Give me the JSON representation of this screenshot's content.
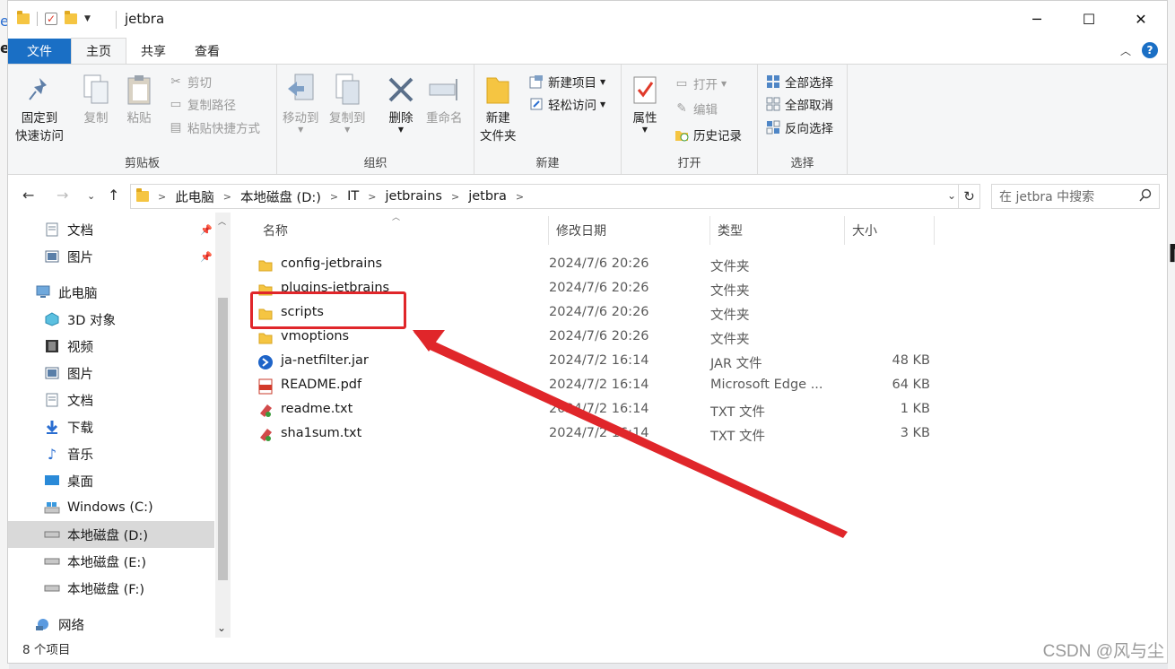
{
  "window": {
    "title": "jetbra",
    "controls": {
      "minimize": "─",
      "maximize": "☐",
      "close": "✕"
    }
  },
  "ribbon_tabs": [
    "文件",
    "主页",
    "共享",
    "查看"
  ],
  "ribbon": {
    "clipboard": {
      "label": "剪贴板",
      "pin": [
        "固定到",
        "快速访问"
      ],
      "copy": "复制",
      "paste": "粘贴",
      "cut": "剪切",
      "copy_path": "复制路径",
      "paste_shortcut": "粘贴快捷方式"
    },
    "organize": {
      "label": "组织",
      "move_to": "移动到",
      "copy_to": "复制到",
      "delete": "删除",
      "rename": "重命名"
    },
    "new": {
      "label": "新建",
      "new_folder": [
        "新建",
        "文件夹"
      ],
      "new_item": "新建项目",
      "easy_access": "轻松访问"
    },
    "open": {
      "label": "打开",
      "properties": "属性",
      "open": "打开",
      "edit": "编辑",
      "history": "历史记录"
    },
    "select": {
      "label": "选择",
      "select_all": "全部选择",
      "select_none": "全部取消",
      "invert": "反向选择"
    }
  },
  "address": {
    "crumbs": [
      "此电脑",
      "本地磁盘 (D:)",
      "IT",
      "jetbrains",
      "jetbra"
    ],
    "search_placeholder": "在 jetbra 中搜索"
  },
  "nav": {
    "quick": [
      {
        "label": "文档",
        "icon": "document-icon"
      },
      {
        "label": "图片",
        "icon": "picture-icon"
      }
    ],
    "this_pc": "此电脑",
    "pc_items": [
      {
        "label": "3D 对象",
        "icon": "3d-objects-icon"
      },
      {
        "label": "视频",
        "icon": "video-icon"
      },
      {
        "label": "图片",
        "icon": "picture-icon"
      },
      {
        "label": "文档",
        "icon": "document-icon"
      },
      {
        "label": "下载",
        "icon": "download-icon"
      },
      {
        "label": "音乐",
        "icon": "music-icon"
      },
      {
        "label": "桌面",
        "icon": "desktop-icon"
      },
      {
        "label": "Windows (C:)",
        "icon": "windows-drive-icon"
      },
      {
        "label": "本地磁盘 (D:)",
        "icon": "drive-icon",
        "selected": true
      },
      {
        "label": "本地磁盘 (E:)",
        "icon": "drive-icon"
      },
      {
        "label": "本地磁盘 (F:)",
        "icon": "drive-icon"
      }
    ],
    "network": "网络"
  },
  "columns": {
    "name": "名称",
    "date": "修改日期",
    "type": "类型",
    "size": "大小"
  },
  "files": [
    {
      "name": "config-jetbrains",
      "date": "2024/7/6 20:26",
      "type": "文件夹",
      "size": "",
      "icon": "folder-icon"
    },
    {
      "name": "plugins-jetbrains",
      "date": "2024/7/6 20:26",
      "type": "文件夹",
      "size": "",
      "icon": "folder-icon"
    },
    {
      "name": "scripts",
      "date": "2024/7/6 20:26",
      "type": "文件夹",
      "size": "",
      "icon": "folder-icon"
    },
    {
      "name": "vmoptions",
      "date": "2024/7/6 20:26",
      "type": "文件夹",
      "size": "",
      "icon": "folder-icon"
    },
    {
      "name": "ja-netfilter.jar",
      "date": "2024/7/2 16:14",
      "type": "JAR 文件",
      "size": "48 KB",
      "icon": "jar-icon"
    },
    {
      "name": "README.pdf",
      "date": "2024/7/2 16:14",
      "type": "Microsoft Edge ...",
      "size": "64 KB",
      "icon": "pdf-icon"
    },
    {
      "name": "readme.txt",
      "date": "2024/7/2 16:14",
      "type": "TXT 文件",
      "size": "1 KB",
      "icon": "txt-icon"
    },
    {
      "name": "sha1sum.txt",
      "date": "2024/7/2 16:14",
      "type": "TXT 文件",
      "size": "3 KB",
      "icon": "txt-icon"
    }
  ],
  "status": "8 个项目",
  "watermark": "CSDN @风与尘",
  "background": {
    "left_top": "e",
    "left_second": "e",
    "right_char": "M"
  },
  "colors": {
    "file_tab": "#1a6fc5",
    "annotation": "#e0262a",
    "selected_nav": "#d9d9d9"
  }
}
